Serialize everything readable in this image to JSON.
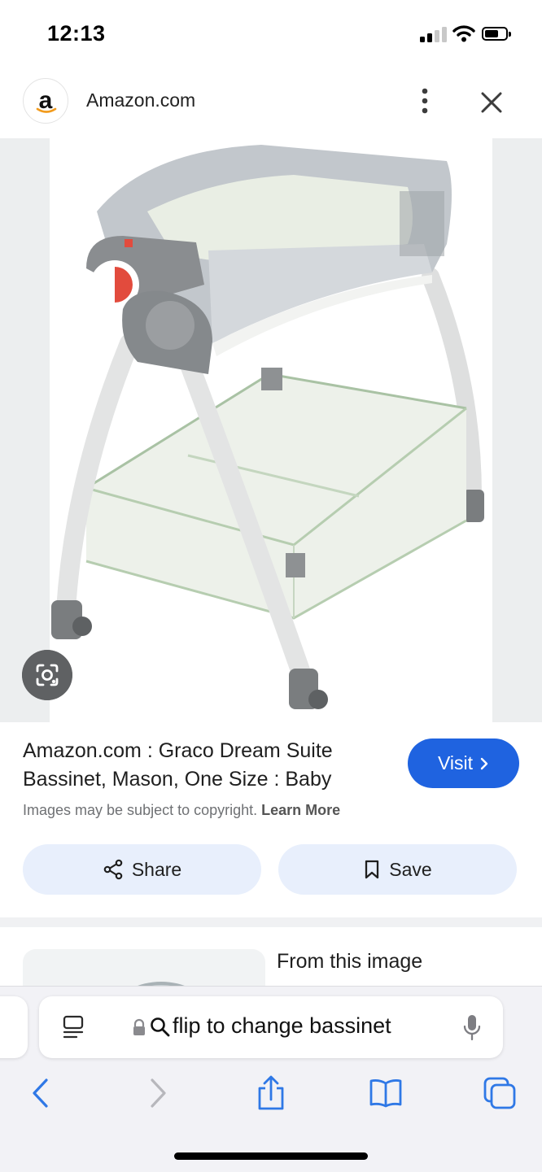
{
  "status": {
    "time": "12:13"
  },
  "header": {
    "logo_letter": "a",
    "site_title": "Amazon.com"
  },
  "result": {
    "title": "Amazon.com : Graco Dream Suite Bassinet, Mason, One Size : Baby",
    "visit_label": "Visit",
    "copyright_text": "Images may be subject to copyright.",
    "learn_more": "Learn More",
    "share_label": "Share",
    "save_label": "Save"
  },
  "related": {
    "heading": "From this image"
  },
  "browser": {
    "url_text": "flip to change bassinet"
  },
  "colors": {
    "accent": "#1f63e0",
    "pill_bg": "#e8effc",
    "toolbar_bg": "#f2f2f6",
    "ios_blue": "#2f78e6"
  },
  "icons": [
    "more-vert-icon",
    "close-icon",
    "lens-icon",
    "share-icon",
    "bookmark-icon",
    "reader-icon",
    "lock-icon",
    "search-icon",
    "mic-icon",
    "back-icon",
    "forward-icon",
    "share-sheet-icon",
    "bookmarks-icon",
    "tabs-icon"
  ]
}
